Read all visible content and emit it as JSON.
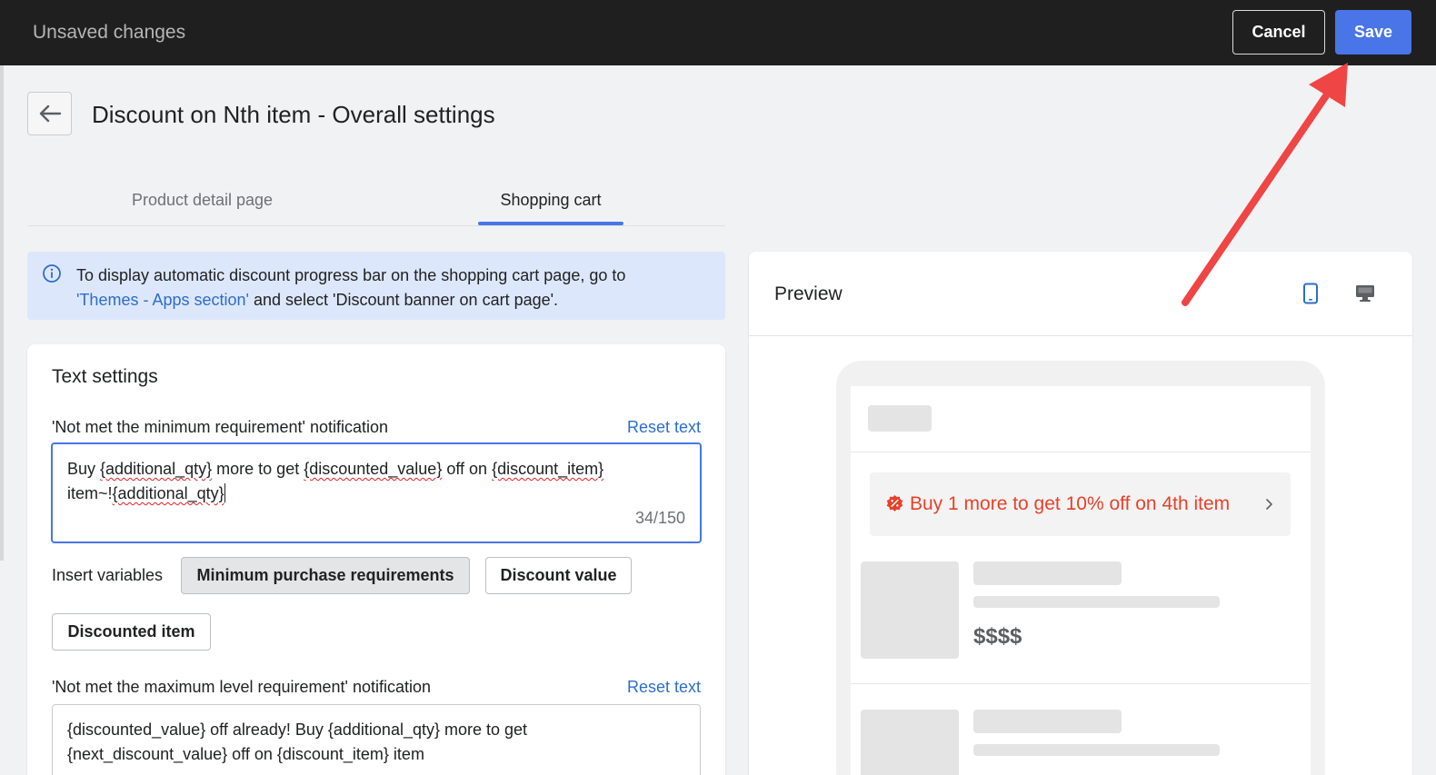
{
  "topbar": {
    "title": "Unsaved changes",
    "cancel_label": "Cancel",
    "save_label": "Save"
  },
  "header": {
    "title": "Discount on Nth item - Overall settings",
    "back_icon": "arrow-left-icon"
  },
  "tabs": [
    {
      "label": "Product detail page",
      "active": false
    },
    {
      "label": "Shopping cart",
      "active": true
    }
  ],
  "banner": {
    "icon": "info-icon",
    "text_before": "To display automatic discount progress bar on the shopping cart page, go to ",
    "link": "'Themes - Apps section'",
    "text_after": " and select 'Discount banner on cart page'."
  },
  "text_settings": {
    "heading": "Text settings",
    "field1": {
      "label": "'Not met the minimum requirement' notification",
      "reset_label": "Reset text",
      "parts": [
        "Buy ",
        "{additional_qty}",
        " more to get ",
        "{discounted_value}",
        " off on ",
        "{discount_item}",
        "item~!",
        "{additional_qty}"
      ],
      "count": "34/150"
    },
    "insert_label": "Insert variables",
    "variables": [
      "Minimum purchase requirements",
      "Discount value",
      "Discounted item"
    ],
    "field2": {
      "label": "'Not met the maximum level requirement' notification",
      "reset_label": "Reset text",
      "line1": "{discounted_value} off already! Buy {additional_qty} more to get",
      "line2": "{next_discount_value} off on {discount_item} item"
    }
  },
  "preview": {
    "title": "Preview",
    "mobile_icon": "mobile-icon",
    "desktop_icon": "desktop-icon",
    "promo_text": "Buy 1 more to get 10% off on 4th item",
    "promo_icon": "discount-badge-icon",
    "price": "$$$$"
  },
  "colors": {
    "topbar_bg": "#1f1f1f",
    "accent": "#4a75e8",
    "link": "#2c6ecb",
    "promo": "#e8412a",
    "annotation_arrow": "#f04545"
  }
}
